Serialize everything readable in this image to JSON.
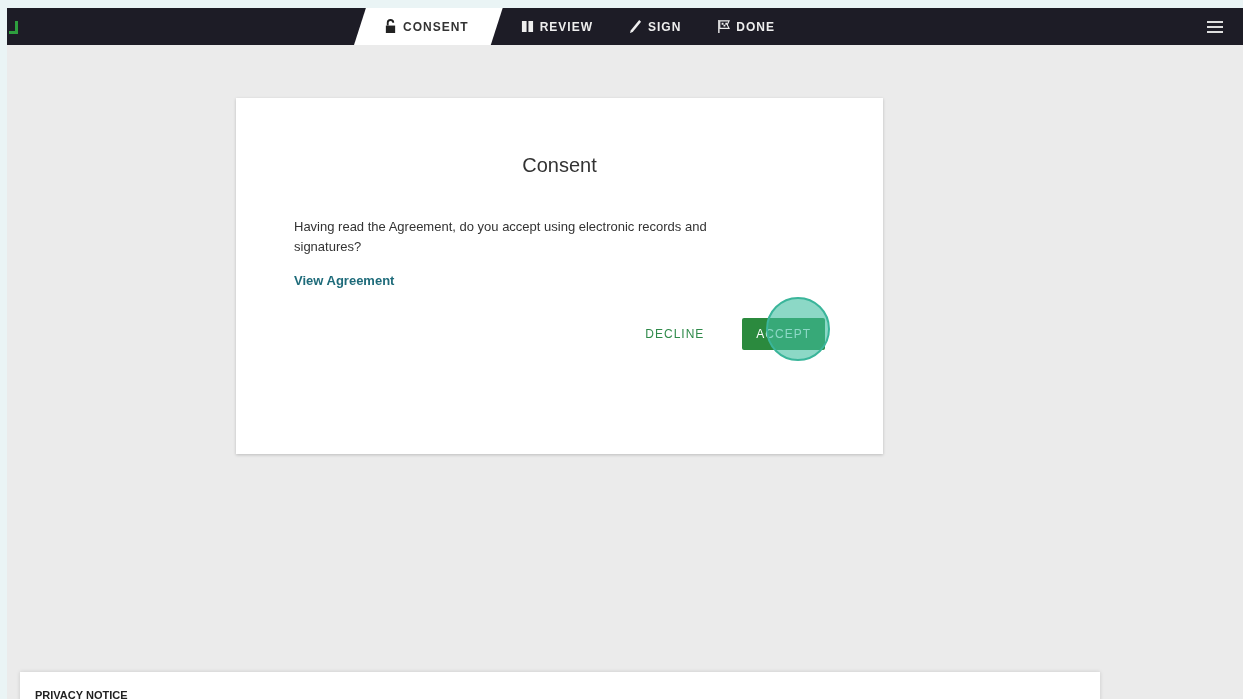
{
  "steps": [
    {
      "label": "CONSENT",
      "kind": "consent",
      "selected": true
    },
    {
      "label": "REVIEW",
      "kind": "review",
      "selected": false
    },
    {
      "label": "SIGN",
      "kind": "sign",
      "selected": false
    },
    {
      "label": "DONE",
      "kind": "done",
      "selected": false
    }
  ],
  "card": {
    "title": "Consent",
    "text": "Having read the Agreement, do you accept using electronic records and signatures?",
    "link": "View Agreement",
    "buttons": [
      {
        "label": "DECLINE",
        "kind": "text",
        "tap_highlight": false
      },
      {
        "label": "ACCEPT",
        "kind": "primary",
        "tap_highlight": true
      }
    ]
  },
  "privacy_notice": {
    "title": "PRIVACY NOTICE"
  }
}
